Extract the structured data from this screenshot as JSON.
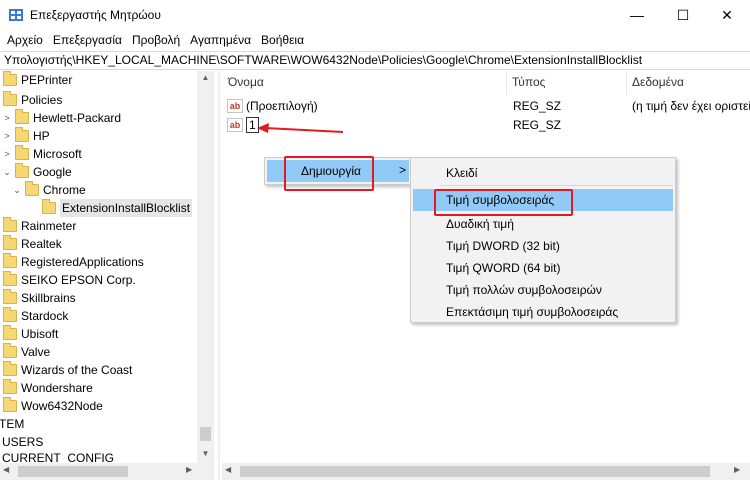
{
  "window": {
    "title": "Επεξεργαστής Μητρώου",
    "minimize_glyph": "—",
    "maximize_glyph": "☐",
    "close_glyph": "✕"
  },
  "menu": {
    "items": [
      "Αρχείο",
      "Επεξεργασία",
      "Προβολή",
      "Αγαπημένα",
      "Βοήθεια"
    ]
  },
  "address": {
    "path": "Υπολογιστής\\HKEY_LOCAL_MACHINE\\SOFTWARE\\WOW6432Node\\Policies\\Google\\Chrome\\ExtensionInstallBlocklist"
  },
  "tree": {
    "items": [
      {
        "label": "PEPrinter",
        "chevron": ""
      },
      {
        "label": "Policies",
        "chevron": "⌄"
      },
      {
        "label": "Hewlett-Packard",
        "chevron": ">"
      },
      {
        "label": "HP",
        "chevron": ">"
      },
      {
        "label": "Microsoft",
        "chevron": ">"
      },
      {
        "label": "Google",
        "chevron": "⌄"
      },
      {
        "label": "Chrome",
        "chevron": "⌄"
      },
      {
        "label": "ExtensionInstallBlocklist",
        "chevron": ""
      },
      {
        "label": "Rainmeter",
        "chevron": ""
      },
      {
        "label": "Realtek",
        "chevron": ""
      },
      {
        "label": "RegisteredApplications",
        "chevron": ""
      },
      {
        "label": "SEIKO EPSON Corp.",
        "chevron": ""
      },
      {
        "label": "Skillbrains",
        "chevron": ""
      },
      {
        "label": "Stardock",
        "chevron": ""
      },
      {
        "label": "Ubisoft",
        "chevron": ""
      },
      {
        "label": "Valve",
        "chevron": ""
      },
      {
        "label": "Wizards of the Coast",
        "chevron": ""
      },
      {
        "label": "Wondershare",
        "chevron": ""
      },
      {
        "label": "Wow6432Node",
        "chevron": ""
      },
      {
        "label": "TEM",
        "chevron": ""
      },
      {
        "label": "USERS",
        "chevron": ""
      },
      {
        "label": "CURRENT_CONFIG",
        "chevron": ""
      }
    ]
  },
  "list": {
    "columns": [
      "Όνομα",
      "Τύπος",
      "Δεδομένα"
    ],
    "rows": [
      {
        "icon": "ab",
        "name": "(Προεπιλογή)",
        "type": "REG_SZ",
        "data": "(η τιμή δεν έχει οριστεί)"
      },
      {
        "icon": "ab",
        "name": "1",
        "type": "REG_SZ",
        "data": ""
      }
    ]
  },
  "context_menu": {
    "new_label": "Δημιουργία",
    "new_arrow": ">",
    "submenu": [
      "Κλειδί",
      "Τιμή συμβολοσειράς",
      "Δυαδική τιμή",
      "Τιμή DWORD (32 bit)",
      "Τιμή QWORD (64 bit)",
      "Τιμή πολλών συμβολοσειρών",
      "Επεκτάσιμη τιμή συμβολοσειράς"
    ]
  },
  "colors": {
    "highlight": "#91c9f7",
    "annotation": "#e01b24",
    "folder": "#f6d776"
  }
}
